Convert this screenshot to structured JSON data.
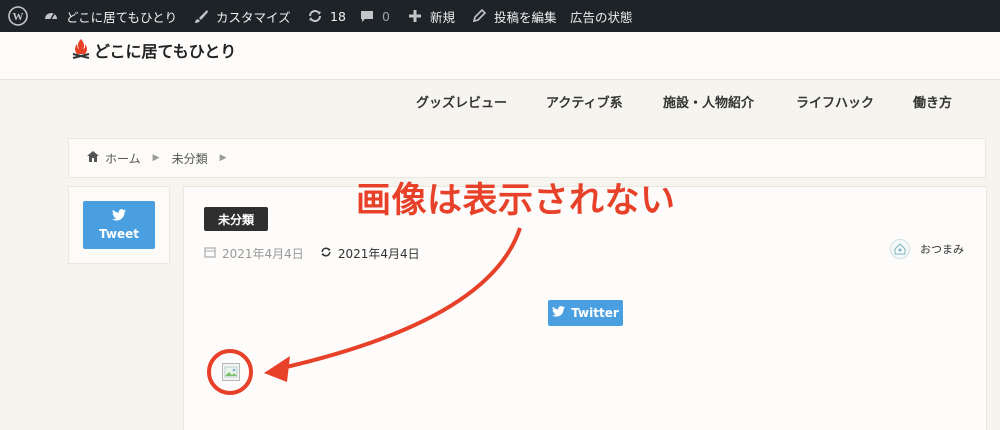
{
  "adminbar": {
    "site_name": "どこに居てもひとり",
    "customize": "カスタマイズ",
    "updates_count": "18",
    "comments_count": "0",
    "new": "新規",
    "edit_post": "投稿を編集",
    "ad_status": "広告の状態"
  },
  "header": {
    "logo_text": "どこに居てもひとり"
  },
  "nav": {
    "items": [
      "グッズレビュー",
      "アクティブ系",
      "施設・人物紹介",
      "ライフハック",
      "働き方"
    ]
  },
  "breadcrumb": {
    "home": "ホーム",
    "category": "未分類"
  },
  "share": {
    "tweet_label": "Tweet"
  },
  "post": {
    "category": "未分類",
    "published": "2021年4月4日",
    "updated": "2021年4月4日",
    "author": "おつまみ",
    "twitter_label": "Twitter"
  },
  "annotation": {
    "text": "画像は表示されない",
    "color": "#e8412a"
  }
}
